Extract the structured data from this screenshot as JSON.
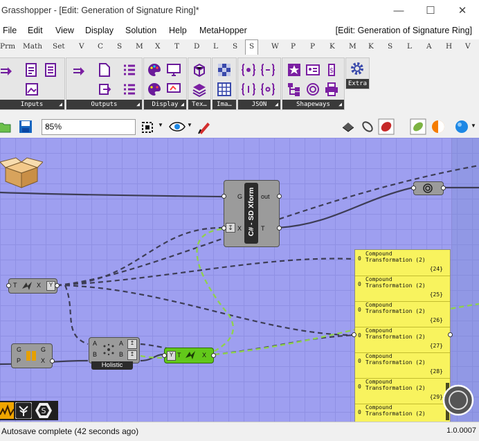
{
  "window": {
    "title": "Grasshopper - [Edit: Generation of Signature Ring]*",
    "controls": [
      "minimize-icon",
      "maximize-icon",
      "close-icon"
    ]
  },
  "menubar": {
    "items": [
      "File",
      "Edit",
      "View",
      "Display",
      "Solution",
      "Help",
      "MetaHopper"
    ],
    "document_label": "[Edit: Generation of Signature Ring]"
  },
  "tabs": [
    "Prm",
    "Math",
    "Set",
    "V",
    "C",
    "S",
    "M",
    "X",
    "T",
    "D",
    "L",
    "S",
    "S",
    "W",
    "P",
    "P",
    "K",
    "M",
    "K",
    "S",
    "L",
    "A",
    "H",
    "V"
  ],
  "active_tab": "S",
  "ribbon": {
    "groups": [
      "Inputs",
      "Outputs",
      "Display",
      "Tex…",
      "Ima…",
      "JSON",
      "Shapeways",
      "Extra"
    ]
  },
  "toolbar": {
    "zoom_value": "85%"
  },
  "canvas": {
    "script_component": {
      "name": "C# - SD Xform",
      "inputs": [
        "G",
        "X"
      ],
      "outputs": [
        "out",
        "T"
      ]
    },
    "transform_left": {
      "inputs": [
        "T"
      ],
      "outputs": [
        "X"
      ]
    },
    "boolean_component": {
      "inputs": [
        "G",
        "P"
      ],
      "outputs": [
        "G",
        "X"
      ]
    },
    "holistic_component": {
      "label": "Holistic",
      "inputs": [
        "A",
        "B"
      ],
      "outputs": [
        "A",
        "B"
      ]
    },
    "transform_green": {
      "inputs": [
        "T"
      ],
      "outputs": [
        "X"
      ]
    },
    "panel": {
      "rows": [
        {
          "index": "0",
          "text": "Compound\nTransformation (2)",
          "path": "{24}"
        },
        {
          "index": "0",
          "text": "Compound\nTransformation (2)",
          "path": "{25}"
        },
        {
          "index": "0",
          "text": "Compound\nTransformation (2)",
          "path": "{26}"
        },
        {
          "index": "0",
          "text": "Compound\nTransformation (2)",
          "path": "{27}"
        },
        {
          "index": "0",
          "text": "Compound\nTransformation (2)",
          "path": "{28}"
        },
        {
          "index": "0",
          "text": "Compound\nTransformation (2)",
          "path": "{29}"
        },
        {
          "index": "0",
          "text": "Compound\nTransformation (2)",
          "path": ""
        }
      ]
    }
  },
  "status": {
    "message": "Autosave complete (42 seconds ago)",
    "version": "1.0.0007"
  },
  "colors": {
    "canvas": "#9e9ff0",
    "panel": "#f8f35e",
    "green_component": "#62c81a",
    "ribbon_icon": "#7b1fa2"
  }
}
